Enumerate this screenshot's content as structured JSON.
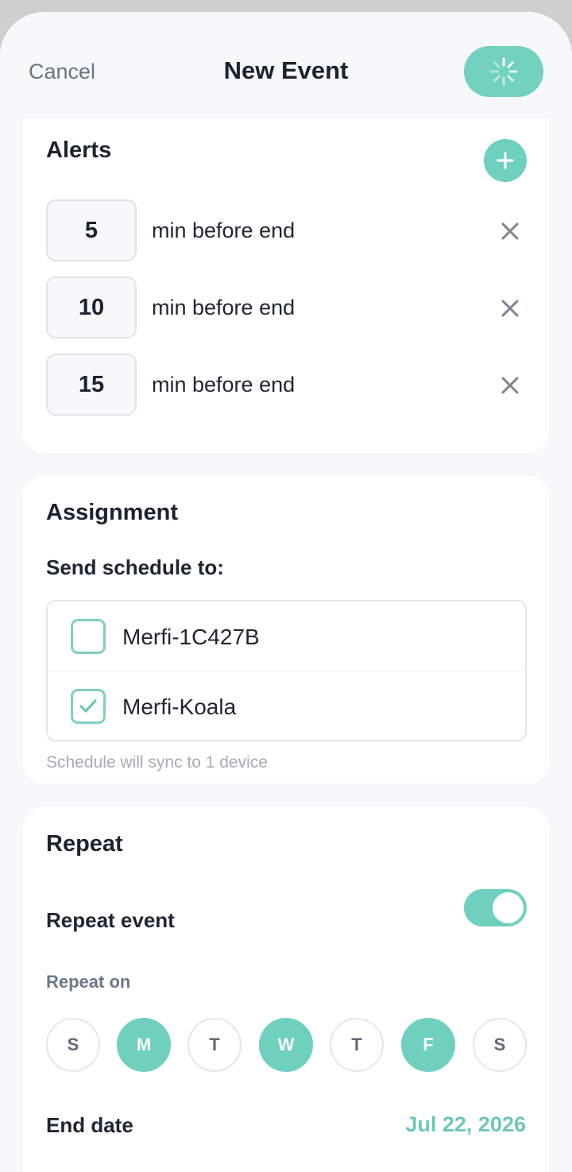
{
  "header": {
    "cancel_label": "Cancel",
    "title": "New Event"
  },
  "alerts": {
    "title": "Alerts",
    "items": [
      {
        "value": "5",
        "label": "min before end"
      },
      {
        "value": "10",
        "label": "min before end"
      },
      {
        "value": "15",
        "label": "min before end"
      }
    ]
  },
  "assignment": {
    "title": "Assignment",
    "subtitle": "Send schedule to:",
    "devices": [
      {
        "name": "Merfi-1C427B",
        "checked": false
      },
      {
        "name": "Merfi-Koala",
        "checked": true
      }
    ],
    "sync_note": "Schedule will sync to 1 device"
  },
  "repeat": {
    "title": "Repeat",
    "repeat_event_label": "Repeat event",
    "repeat_event_on": true,
    "repeat_on_label": "Repeat on",
    "days": [
      {
        "label": "S",
        "selected": false
      },
      {
        "label": "M",
        "selected": true
      },
      {
        "label": "T",
        "selected": false
      },
      {
        "label": "W",
        "selected": true
      },
      {
        "label": "T",
        "selected": false
      },
      {
        "label": "F",
        "selected": true
      },
      {
        "label": "S",
        "selected": false
      }
    ],
    "end_date_label": "End date",
    "end_date_value": "Jul 22, 2026"
  },
  "colors": {
    "accent": "#6fd0bf",
    "accent_text": "#6fc7b7"
  },
  "icons": {
    "save": "loading-spinner-icon",
    "add": "plus-icon",
    "remove": "close-icon",
    "check": "checkmark-icon"
  }
}
